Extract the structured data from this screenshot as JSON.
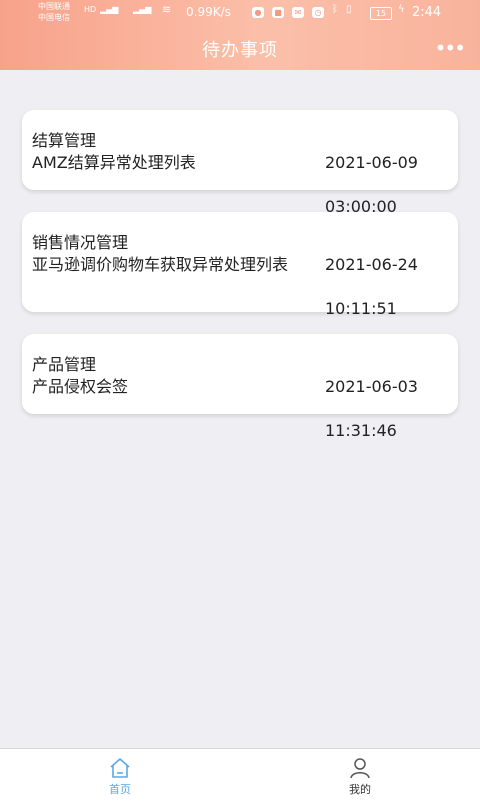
{
  "status_bar": {
    "carrier1": "中国联通",
    "carrier2": "中国电信",
    "network": "0.99K/s",
    "battery": "15",
    "time": "2:44"
  },
  "header": {
    "title": "待办事项"
  },
  "todos": [
    {
      "category": "结算管理",
      "desc": "AMZ结算异常处理列表",
      "date": "2021-06-09",
      "time": "03:00:00"
    },
    {
      "category": "销售情况管理",
      "desc": "亚马逊调价购物车获取异常处理列表",
      "date": "2021-06-24",
      "time": "10:11:51"
    },
    {
      "category": "产品管理",
      "desc": "产品侵权会签",
      "date": "2021-06-03",
      "time": "11:31:46"
    }
  ],
  "tabbar": {
    "home_label": "首页",
    "mine_label": "我的",
    "active_color": "#5aa9e6"
  }
}
